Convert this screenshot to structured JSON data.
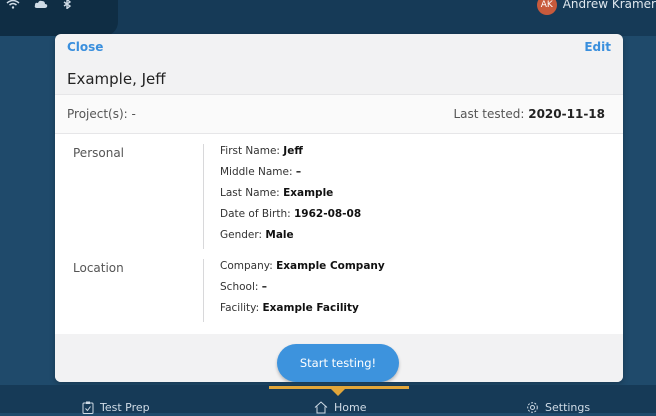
{
  "user": {
    "initials": "AK",
    "name": "Andrew Kramer"
  },
  "modal": {
    "close_label": "Close",
    "edit_label": "Edit",
    "person_name": "Example, Jeff",
    "projects_label": "Project(s):",
    "projects_value": "-",
    "last_tested_label": "Last tested:",
    "last_tested_value": "2020-11-18",
    "sections": {
      "personal": {
        "label": "Personal",
        "fields": [
          {
            "label": "First Name:",
            "value": "Jeff"
          },
          {
            "label": "Middle Name:",
            "value": "–"
          },
          {
            "label": "Last Name:",
            "value": "Example"
          },
          {
            "label": "Date of Birth:",
            "value": "1962-08-08"
          },
          {
            "label": "Gender:",
            "value": "Male"
          }
        ]
      },
      "location": {
        "label": "Location",
        "fields": [
          {
            "label": "Company:",
            "value": "Example Company"
          },
          {
            "label": "School:",
            "value": "–"
          },
          {
            "label": "Facility:",
            "value": "Example Facility"
          }
        ]
      }
    },
    "start_button_label": "Start testing!"
  },
  "tabs": [
    {
      "label": "Test Prep",
      "icon": "clipboard-check-icon"
    },
    {
      "label": "Home",
      "icon": "home-icon"
    },
    {
      "label": "Settings",
      "icon": "gear-icon"
    }
  ],
  "colors": {
    "background": "#1f4a6b",
    "accent": "#3d93dd",
    "tab_indicator": "#e2a63a",
    "avatar": "#c85a3c"
  }
}
